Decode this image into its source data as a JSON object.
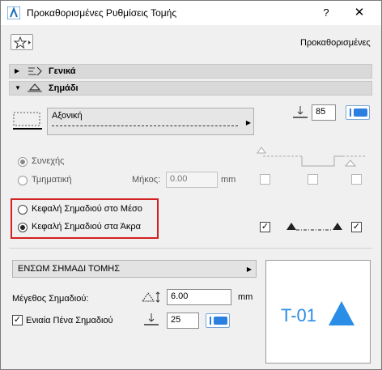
{
  "window": {
    "title": "Προκαθορισμένες Ρυθμίσεις Τομής",
    "help": "?",
    "close": "✕"
  },
  "favorites": {
    "label": "Προκαθορισμένες"
  },
  "sections": {
    "general": "Γενικά",
    "marker": "Σημάδι"
  },
  "line": {
    "linetype_name": "Αξονική",
    "pen_number": "85"
  },
  "segment_type": {
    "continuous": "Συνεχής",
    "segmented": "Τμηματική",
    "length_label": "Μήκος:",
    "length_value": "0.00",
    "length_unit": "mm"
  },
  "marker_heads": {
    "middle": "Κεφαλή Σημαδιού στο Μέσο",
    "ends": "Κεφαλή Σημαδιού στα Άκρα"
  },
  "marker_type": {
    "value": "ΕΝΣΩΜ ΣΗΜΑΔΙ ΤΟΜΗΣ"
  },
  "marker_size": {
    "label": "Μέγεθος Σημαδιού:",
    "value": "6.00",
    "unit": "mm"
  },
  "uniform_pen": {
    "label": "Ενιαία Πένα Σημαδιού",
    "value": "25",
    "checked": true
  },
  "preview": {
    "marker_text": "T-01"
  },
  "colors": {
    "accent": "#2b8ee6",
    "highlight": "#d32020"
  }
}
